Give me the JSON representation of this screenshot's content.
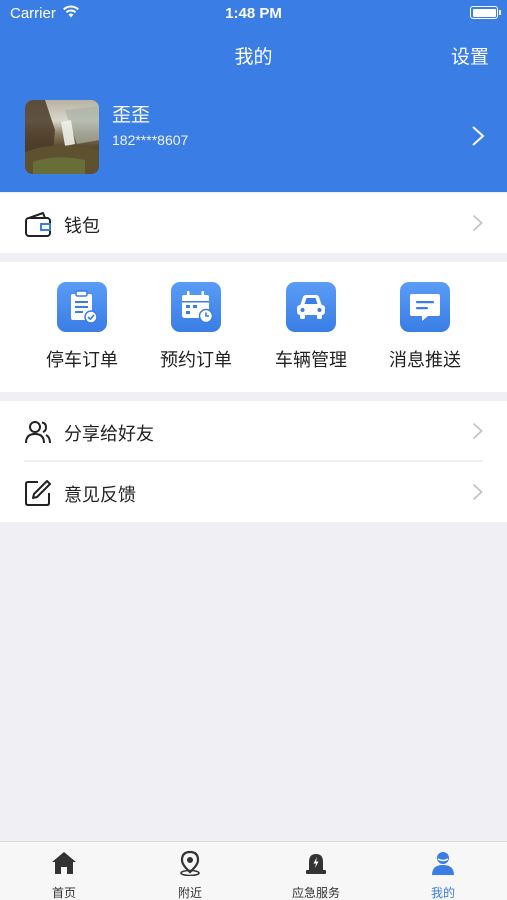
{
  "status_bar": {
    "carrier": "Carrier",
    "time": "1:48 PM"
  },
  "nav": {
    "title": "我的",
    "settings_label": "设置"
  },
  "profile": {
    "name": "歪歪",
    "phone": "182****8607"
  },
  "wallet": {
    "label": "钱包"
  },
  "quick_actions": [
    {
      "label": "停车订单",
      "icon": "parking-order-icon"
    },
    {
      "label": "预约订单",
      "icon": "reservation-order-icon"
    },
    {
      "label": "车辆管理",
      "icon": "car-icon"
    },
    {
      "label": "消息推送",
      "icon": "message-icon"
    }
  ],
  "menu": [
    {
      "label": "分享给好友",
      "icon": "users-icon"
    },
    {
      "label": "意见反馈",
      "icon": "feedback-icon"
    }
  ],
  "tabbar": {
    "items": [
      {
        "label": "首页",
        "icon": "home-icon"
      },
      {
        "label": "附近",
        "icon": "location-pin-icon"
      },
      {
        "label": "应急服务",
        "icon": "emergency-light-icon"
      },
      {
        "label": "我的",
        "icon": "user-icon"
      }
    ],
    "active_index": 3
  },
  "colors": {
    "primary": "#3a7de5",
    "background": "#efeff4",
    "tab_inactive": "#333333"
  }
}
